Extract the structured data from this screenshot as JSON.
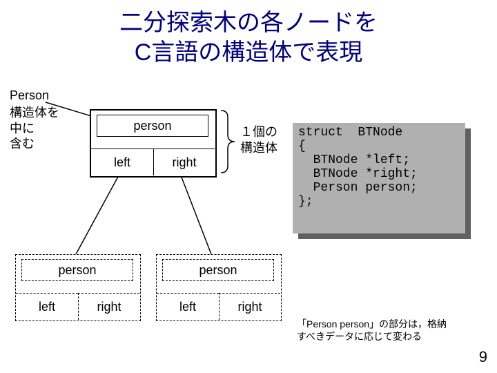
{
  "title_line1": "二分探索木の各ノードを",
  "title_line2": "C言語の構造体で表現",
  "label_person_heading": "Person",
  "annotation_contains": "構造体を\n中に\n含む",
  "annotation_one_struct": "１個の\n構造体",
  "node": {
    "person_label": "person",
    "left_label": "left",
    "right_label": "right"
  },
  "code": {
    "l1": "struct  BTNode",
    "l2": "{",
    "l3": "  BTNode *left;",
    "l4": "  BTNode *right;",
    "l5": "  Person person;",
    "l6": "};"
  },
  "footnote": "「Person person」の部分は，格納\nすべきデータに応じて変わる",
  "page_number": "9"
}
